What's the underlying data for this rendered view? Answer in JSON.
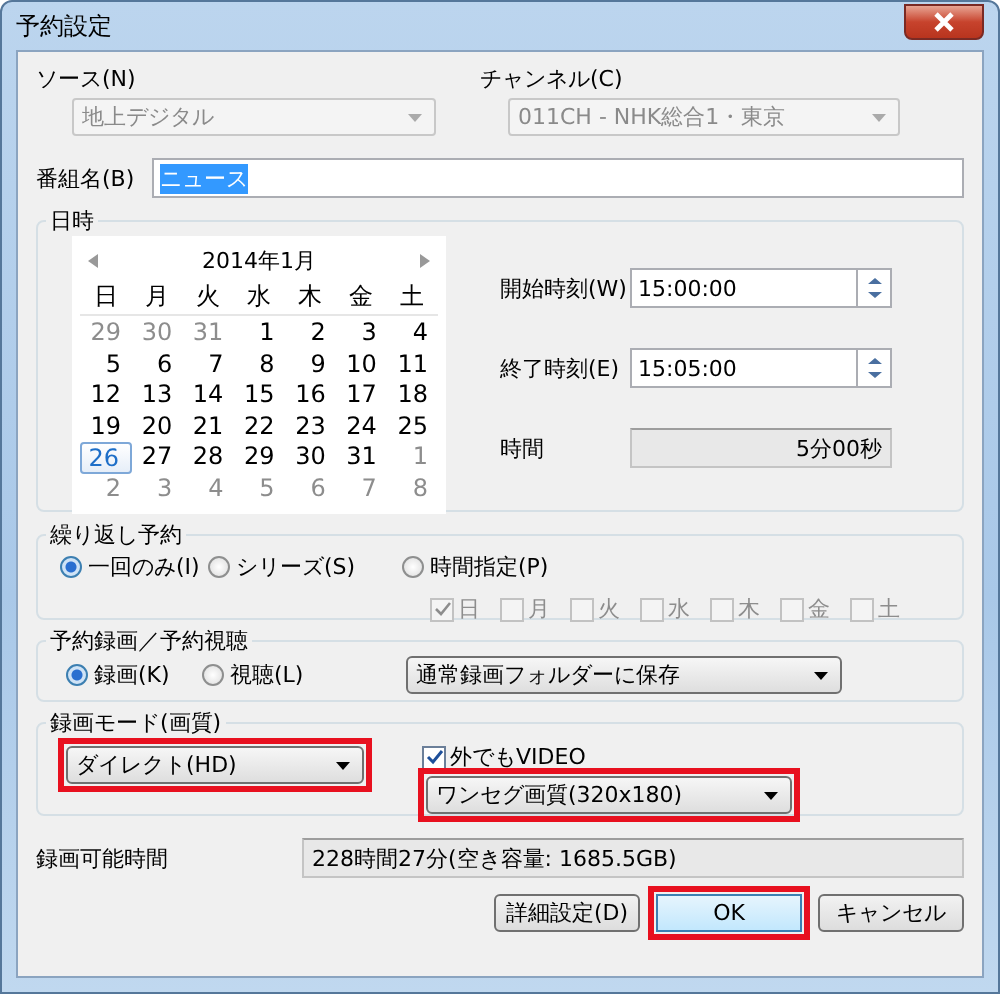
{
  "window": {
    "title": "予約設定"
  },
  "source": {
    "label": "ソース(N)",
    "value": "地上デジタル",
    "disabled": true
  },
  "channel": {
    "label": "チャンネル(C)",
    "value": "011CH - NHK総合1・東京",
    "disabled": true
  },
  "program_name": {
    "label": "番組名(B)",
    "value": "ニュース",
    "selected": true
  },
  "datetime": {
    "title": "日時",
    "calendar": {
      "month": "2014年1月",
      "weekdays": [
        "日",
        "月",
        "火",
        "水",
        "木",
        "金",
        "土"
      ],
      "days": [
        {
          "day": "29",
          "other_month": true,
          "selected": false
        },
        {
          "day": "30",
          "other_month": true,
          "selected": false
        },
        {
          "day": "31",
          "other_month": true,
          "selected": false
        },
        {
          "day": "1",
          "other_month": false,
          "selected": false
        },
        {
          "day": "2",
          "other_month": false,
          "selected": false
        },
        {
          "day": "3",
          "other_month": false,
          "selected": false
        },
        {
          "day": "4",
          "other_month": false,
          "selected": false
        },
        {
          "day": "5",
          "other_month": false,
          "selected": false
        },
        {
          "day": "6",
          "other_month": false,
          "selected": false
        },
        {
          "day": "7",
          "other_month": false,
          "selected": false
        },
        {
          "day": "8",
          "other_month": false,
          "selected": false
        },
        {
          "day": "9",
          "other_month": false,
          "selected": false
        },
        {
          "day": "10",
          "other_month": false,
          "selected": false
        },
        {
          "day": "11",
          "other_month": false,
          "selected": false
        },
        {
          "day": "12",
          "other_month": false,
          "selected": false
        },
        {
          "day": "13",
          "other_month": false,
          "selected": false
        },
        {
          "day": "14",
          "other_month": false,
          "selected": false
        },
        {
          "day": "15",
          "other_month": false,
          "selected": false
        },
        {
          "day": "16",
          "other_month": false,
          "selected": false
        },
        {
          "day": "17",
          "other_month": false,
          "selected": false
        },
        {
          "day": "18",
          "other_month": false,
          "selected": false
        },
        {
          "day": "19",
          "other_month": false,
          "selected": false
        },
        {
          "day": "20",
          "other_month": false,
          "selected": false
        },
        {
          "day": "21",
          "other_month": false,
          "selected": false
        },
        {
          "day": "22",
          "other_month": false,
          "selected": false
        },
        {
          "day": "23",
          "other_month": false,
          "selected": false
        },
        {
          "day": "24",
          "other_month": false,
          "selected": false
        },
        {
          "day": "25",
          "other_month": false,
          "selected": false
        },
        {
          "day": "26",
          "other_month": false,
          "selected": true
        },
        {
          "day": "27",
          "other_month": false,
          "selected": false
        },
        {
          "day": "28",
          "other_month": false,
          "selected": false
        },
        {
          "day": "29",
          "other_month": false,
          "selected": false
        },
        {
          "day": "30",
          "other_month": false,
          "selected": false
        },
        {
          "day": "31",
          "other_month": false,
          "selected": false
        },
        {
          "day": "1",
          "other_month": true,
          "selected": false
        },
        {
          "day": "2",
          "other_month": true,
          "selected": false
        },
        {
          "day": "3",
          "other_month": true,
          "selected": false
        },
        {
          "day": "4",
          "other_month": true,
          "selected": false
        },
        {
          "day": "5",
          "other_month": true,
          "selected": false
        },
        {
          "day": "6",
          "other_month": true,
          "selected": false
        },
        {
          "day": "7",
          "other_month": true,
          "selected": false
        },
        {
          "day": "8",
          "other_month": true,
          "selected": false
        }
      ]
    },
    "start": {
      "label": "開始時刻(W)",
      "value": "15:00:00"
    },
    "end": {
      "label": "終了時刻(E)",
      "value": "15:05:00"
    },
    "duration": {
      "label": "時間",
      "value": "5分00秒"
    }
  },
  "repeat": {
    "title": "繰り返し予約",
    "options": [
      {
        "label": "一回のみ(I)",
        "selected": true
      },
      {
        "label": "シリーズ(S)",
        "selected": false
      },
      {
        "label": "時間指定(P)",
        "selected": false
      }
    ],
    "weekdays": [
      {
        "label": "日",
        "checked": true,
        "disabled": true
      },
      {
        "label": "月",
        "checked": false,
        "disabled": true
      },
      {
        "label": "火",
        "checked": false,
        "disabled": true
      },
      {
        "label": "水",
        "checked": false,
        "disabled": true
      },
      {
        "label": "木",
        "checked": false,
        "disabled": true
      },
      {
        "label": "金",
        "checked": false,
        "disabled": true
      },
      {
        "label": "土",
        "checked": false,
        "disabled": true
      }
    ]
  },
  "reservation": {
    "title": "予約録画／予約視聴",
    "options": [
      {
        "label": "録画(K)",
        "selected": true
      },
      {
        "label": "視聴(L)",
        "selected": false
      }
    ],
    "folder": {
      "value": "通常録画フォルダーに保存"
    }
  },
  "recording_mode": {
    "title": "録画モード(画質)",
    "mode": {
      "value": "ダイレクト(HD)",
      "highlighted": true
    },
    "video": {
      "label": "外でもVIDEO",
      "checked": true
    },
    "quality": {
      "value": "ワンセグ画質(320x180)",
      "highlighted": true
    }
  },
  "available": {
    "label": "録画可能時間",
    "value": "228時間27分(空き容量: 1685.5GB)"
  },
  "buttons": [
    {
      "label": "詳細設定(D)",
      "default": false,
      "highlighted": false
    },
    {
      "label": "OK",
      "default": true,
      "highlighted": true
    },
    {
      "label": "キャンセル",
      "default": false,
      "highlighted": false
    }
  ]
}
